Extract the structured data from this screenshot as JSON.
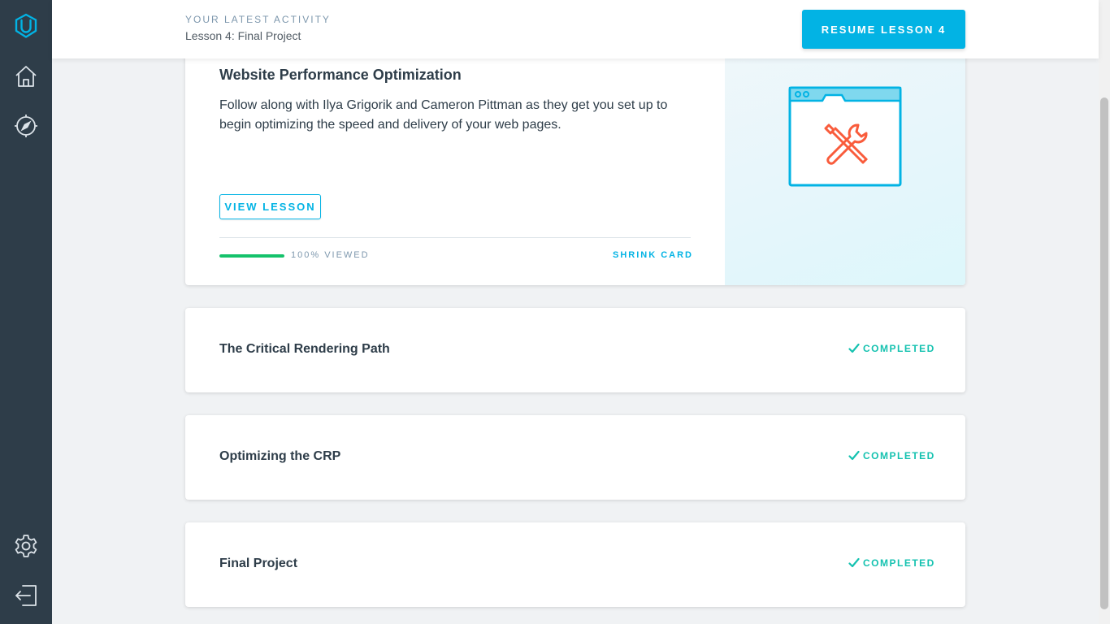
{
  "sidebar": {
    "icons": [
      "udacity-logo-icon",
      "home-icon",
      "compass-icon",
      "gear-icon",
      "logout-icon"
    ]
  },
  "header": {
    "kicker": "YOUR LATEST ACTIVITY",
    "activity": "Lesson 4: Final Project",
    "resume_label": "RESUME LESSON 4"
  },
  "main_card": {
    "title": "Website Performance Optimization",
    "description": "Follow along with Ilya Grigorik and Cameron Pittman as they get you set up to begin optimizing the speed and delivery of your web pages.",
    "view_label": "VIEW LESSON",
    "progress_fraction": 1.0,
    "progress_label": "100% VIEWED",
    "shrink_label": "SHRINK CARD",
    "art_icon": "browser-tools-icon"
  },
  "lessons": [
    {
      "title": "The Critical Rendering Path",
      "status": "COMPLETED"
    },
    {
      "title": "Optimizing the CRP",
      "status": "COMPLETED"
    },
    {
      "title": "Final Project",
      "status": "COMPLETED"
    }
  ],
  "colors": {
    "accent": "#02b3e4",
    "sidebar": "#2e3d49",
    "progress": "#15c26b",
    "completed": "#15c2b0",
    "art_red": "#f95c3c"
  }
}
